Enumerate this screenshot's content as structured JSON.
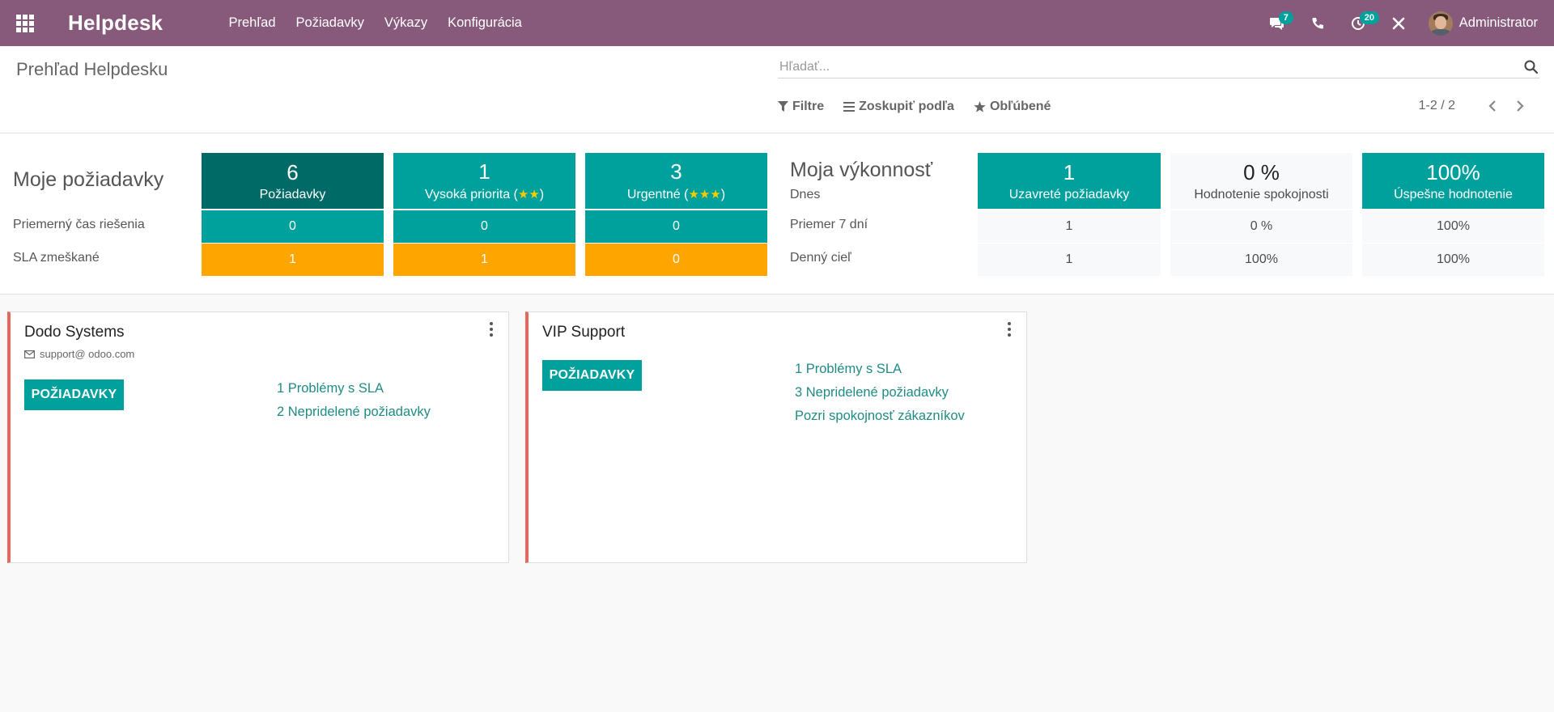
{
  "navbar": {
    "brand": "Helpdesk",
    "menu": [
      "Prehľad",
      "Požiadavky",
      "Výkazy",
      "Konfigurácia"
    ],
    "messages_count": "7",
    "activities_count": "20",
    "user_name": "Administrator",
    "color": "#875a7b"
  },
  "control_panel": {
    "breadcrumb": "Prehľad Helpdesku",
    "search_placeholder": "Hľadať...",
    "filters_label": "Filtre",
    "groupby_label": "Zoskupiť podľa",
    "favorites_label": "Obľúbené",
    "pager": "1-2 / 2"
  },
  "dashboard": {
    "my_tickets": {
      "title": "Moje požiadavky",
      "row_labels": {
        "avg_time": "Priemerný čas riešenia",
        "sla_missed": "SLA zmeškané"
      },
      "columns": [
        {
          "count": "6",
          "label": "Požiadavky",
          "stars": "",
          "avg_time": "0",
          "sla_missed": "1"
        },
        {
          "count": "1",
          "label": "Vysoká priorita (",
          "stars": "★★",
          "label_end": ")",
          "avg_time": "0",
          "sla_missed": "1"
        },
        {
          "count": "3",
          "label": "Urgentné (",
          "stars": "★★★",
          "label_end": ")",
          "avg_time": "0",
          "sla_missed": "0"
        }
      ]
    },
    "performance": {
      "title": "Moja výkonnosť",
      "row_labels": {
        "today": "Dnes",
        "avg7": "Priemer 7 dní",
        "target": "Denný cieľ"
      },
      "columns": [
        {
          "value": "1",
          "label": "Uzavreté požiadavky",
          "avg7": "1",
          "target": "1"
        },
        {
          "value": "0 %",
          "label": "Hodnotenie spokojnosti",
          "avg7": "0 %",
          "target": "100%"
        },
        {
          "value": "100%",
          "label": "Úspešne hodnotenie",
          "avg7": "100%",
          "target": "100%"
        }
      ]
    },
    "colors": {
      "dark": "#006a67",
      "teal": "#00a09d",
      "orange": "#ffa500"
    }
  },
  "teams": [
    {
      "name": "Dodo Systems",
      "email": "support@ odoo.com",
      "button": "POŽIADAVKY",
      "links": [
        "1 Problémy s SLA",
        "2 Nepridelené požiadavky"
      ]
    },
    {
      "name": "VIP Support",
      "button": "POŽIADAVKY",
      "links": [
        "1 Problémy s SLA",
        "3 Nepridelené požiadavky",
        "Pozri spokojnosť zákazníkov"
      ]
    }
  ]
}
